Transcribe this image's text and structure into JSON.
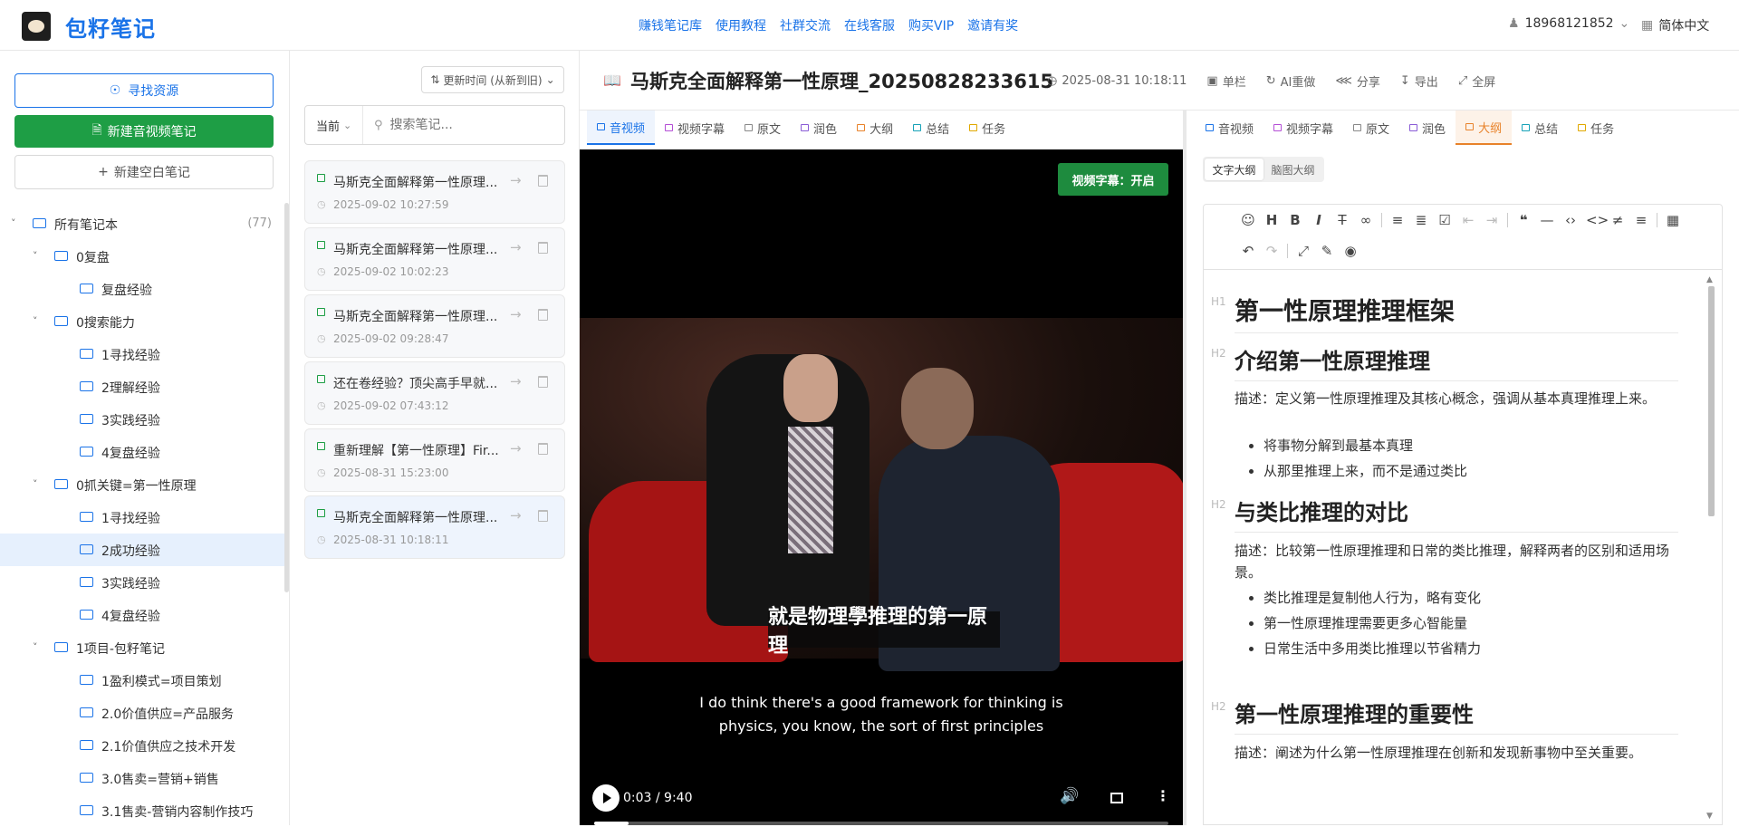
{
  "app": {
    "brand": "包籽笔记"
  },
  "nav": [
    "赚钱笔记库",
    "使用教程",
    "社群交流",
    "在线客服",
    "购买VIP",
    "邀请有奖"
  ],
  "user": {
    "phone": "18968121852",
    "lang": "简体中文"
  },
  "sidebar": {
    "find_label": "寻找资源",
    "new_av_label": "新建音视频笔记",
    "new_blank_label": "新建空白笔记",
    "tree": [
      {
        "label": "所有笔记本",
        "count": "(77)",
        "level": 0,
        "open": true
      },
      {
        "label": "0复盘",
        "level": 1,
        "open": true
      },
      {
        "label": "复盘经验",
        "level": 2
      },
      {
        "label": "0搜索能力",
        "level": 1,
        "open": true
      },
      {
        "label": "1寻找经验",
        "level": 2
      },
      {
        "label": "2理解经验",
        "level": 2
      },
      {
        "label": "3实践经验",
        "level": 2
      },
      {
        "label": "4复盘经验",
        "level": 2
      },
      {
        "label": "0抓关键=第一性原理",
        "level": 1,
        "open": true
      },
      {
        "label": "1寻找经验",
        "level": 2
      },
      {
        "label": "2成功经验",
        "level": 2,
        "selected": true
      },
      {
        "label": "3实践经验",
        "level": 2
      },
      {
        "label": "4复盘经验",
        "level": 2
      },
      {
        "label": "1项目-包籽笔记",
        "level": 1,
        "open": true
      },
      {
        "label": "1盈利模式=项目策划",
        "level": 2
      },
      {
        "label": "2.0价值供应=产品服务",
        "level": 2
      },
      {
        "label": "2.1价值供应之技术开发",
        "level": 2
      },
      {
        "label": "3.0售卖=营销+销售",
        "level": 2
      },
      {
        "label": "3.1售卖-营销内容制作技巧",
        "level": 2
      }
    ]
  },
  "list": {
    "sort_label": "更新时间 (从新到旧)",
    "scope": "当前",
    "search_placeholder": "搜索笔记...",
    "notes": [
      {
        "title": "马斯克全面解释第一性原理...",
        "date": "2025-09-02 10:27:59"
      },
      {
        "title": "马斯克全面解释第一性原理...",
        "date": "2025-09-02 10:02:23"
      },
      {
        "title": "马斯克全面解释第一性原理...",
        "date": "2025-09-02 09:28:47"
      },
      {
        "title": "还在卷经验？顶尖高手早就...",
        "date": "2025-09-02 07:43:12"
      },
      {
        "title": "重新理解【第一性原理】Fir...",
        "date": "2025-08-31 15:23:00"
      },
      {
        "title": "马斯克全面解释第一性原理...",
        "date": "2025-08-31 10:18:11",
        "selected": true
      }
    ]
  },
  "note": {
    "title": "马斯克全面解释第一性原理_20250828233615",
    "time": "2025-08-31 10:18:11",
    "actions": [
      "单栏",
      "AI重做",
      "分享",
      "导出",
      "全屏"
    ]
  },
  "tabs_left": [
    {
      "label": "音视频",
      "color": "#1a73e8"
    },
    {
      "label": "视频字幕",
      "color": "#b44fd6"
    },
    {
      "label": "原文",
      "color": "#888888"
    },
    {
      "label": "润色",
      "color": "#8a5cd6"
    },
    {
      "label": "大纲",
      "color": "#e8822a"
    },
    {
      "label": "总结",
      "color": "#17a2b8"
    },
    {
      "label": "任务",
      "color": "#e0a800"
    }
  ],
  "tabs_right": [
    {
      "label": "音视频",
      "color": "#1a73e8"
    },
    {
      "label": "视频字幕",
      "color": "#b44fd6"
    },
    {
      "label": "原文",
      "color": "#888888"
    },
    {
      "label": "润色",
      "color": "#8a5cd6"
    },
    {
      "label": "大纲",
      "color": "#e8822a"
    },
    {
      "label": "总结",
      "color": "#17a2b8"
    },
    {
      "label": "任务",
      "color": "#e0a800"
    }
  ],
  "video": {
    "badge": "视频字幕：开启",
    "subtitle_cn": "就是物理學推理的第一原理",
    "subtitle_en": "I do think there's a good framework for thinking is physics, you know, the sort of first principles",
    "time": "0:03 / 9:40",
    "progress": 0.0052
  },
  "outline": {
    "modes": [
      "文字大纲",
      "脑图大纲"
    ],
    "h1": "第一性原理推理框架",
    "sections": [
      {
        "h2": "介绍第一性原理推理",
        "desc": "描述：定义第一性原理推理及其核心概念，强调从基本真理推理上来。",
        "items": [
          "将事物分解到最基本真理",
          "从那里推理上来，而不是通过类比"
        ]
      },
      {
        "h2": "与类比推理的对比",
        "desc": "描述：比较第一性原理推理和日常的类比推理，解释两者的区别和适用场景。",
        "items": [
          "类比推理是复制他人行为，略有变化",
          "第一性原理推理需要更多心智能量",
          "日常生活中多用类比推理以节省精力"
        ]
      },
      {
        "h2": "第一性原理推理的重要性",
        "desc": "描述：阐述为什么第一性原理推理在创新和发现新事物中至关重要。",
        "items": []
      }
    ]
  },
  "colors": {
    "accent": "#1a73e8",
    "green": "#1e9e45",
    "orange": "#e8822a"
  }
}
